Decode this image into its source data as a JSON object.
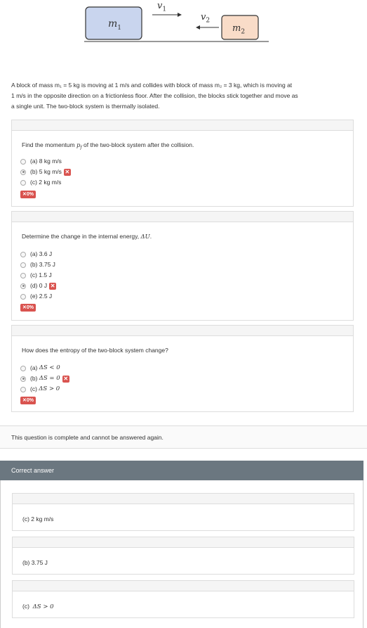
{
  "diagram": {
    "block1_label": "m",
    "block1_sub": "1",
    "block2_label": "m",
    "block2_sub": "2",
    "v1_label": "v",
    "v1_sub": "1",
    "v2_label": "v",
    "v2_sub": "2",
    "block1_color": "#c9d5ee",
    "block2_color": "#f9dcc8"
  },
  "intro": {
    "line1": "A block of mass m₁ = 5 kg is moving at 1 m/s and collides with block of mass m₂ = 3 kg, which is moving at",
    "line2": "1 m/s in the opposite direction on a frictionless floor. After the collision, the blocks stick together and move as",
    "line3": "a single unit. The two-block system is thermally isolated."
  },
  "questions": [
    {
      "prompt_pre": "Find the momentum ",
      "prompt_math": "p",
      "prompt_math_sub": "f",
      "prompt_post": " of the two-block system after the collision.",
      "options": [
        {
          "label": "(a) 8 kg m/s",
          "selected": false,
          "wrong": false
        },
        {
          "label": "(b) 5 kg m/s",
          "selected": true,
          "wrong": true
        },
        {
          "label": "(c) 2 kg m/s",
          "selected": false,
          "wrong": false
        }
      ],
      "score": "0%"
    },
    {
      "prompt_pre": "Determine the change in the internal energy, ",
      "prompt_math": "ΔU",
      "prompt_post": ".",
      "options": [
        {
          "label": "(a) 3.6 J",
          "selected": false,
          "wrong": false
        },
        {
          "label": "(b) 3.75 J",
          "selected": false,
          "wrong": false
        },
        {
          "label": "(c) 1.5 J",
          "selected": false,
          "wrong": false
        },
        {
          "label": "(d) 0 J",
          "selected": true,
          "wrong": true
        },
        {
          "label": "(e) 2.5 J",
          "selected": false,
          "wrong": false
        }
      ],
      "score": "0%"
    },
    {
      "prompt_pre": "How does the entropy of the two-block system change?",
      "options": [
        {
          "label_pre": "(a) ",
          "label_math": "ΔS < 0",
          "selected": false,
          "wrong": false
        },
        {
          "label_pre": "(b) ",
          "label_math": "ΔS = 0",
          "selected": true,
          "wrong": true
        },
        {
          "label_pre": "(c) ",
          "label_math": "ΔS > 0",
          "selected": false,
          "wrong": false
        }
      ],
      "score": "0%"
    }
  ],
  "complete_message": "This question is complete and cannot be answered again.",
  "correct_answer": {
    "title": "Correct answer",
    "answers": [
      {
        "pre": "(c) 2 kg m/s",
        "math": ""
      },
      {
        "pre": "(b) 3.75 J",
        "math": ""
      },
      {
        "pre": "(c) ",
        "math": "ΔS > 0"
      }
    ]
  },
  "colors": {
    "wrong_red": "#d9534f",
    "bar_gray": "#6b7780"
  }
}
